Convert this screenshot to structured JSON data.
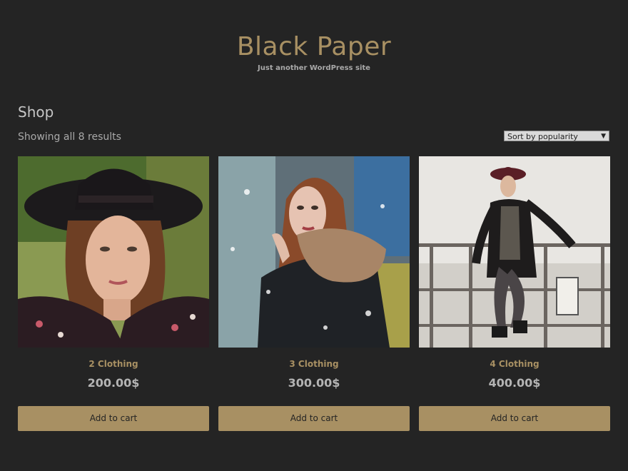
{
  "site": {
    "title": "Black Paper",
    "tagline": "Just another WordPress site"
  },
  "shop": {
    "title": "Shop",
    "results_count": "Showing all 8 results",
    "sort": {
      "selected": "Sort by popularity"
    }
  },
  "products": [
    {
      "name": "2 Clothing",
      "price": "200.00$",
      "button": "Add to cart",
      "image": "woman-black-hat-portrait"
    },
    {
      "name": "3 Clothing",
      "price": "300.00$",
      "button": "Add to cart",
      "image": "woman-fur-collar-snow"
    },
    {
      "name": "4 Clothing",
      "price": "400.00$",
      "button": "Add to cart",
      "image": "woman-coat-railing-harbor"
    }
  ],
  "colors": {
    "background": "#242424",
    "accent": "#a89063",
    "text_muted": "#a9a9a9"
  }
}
